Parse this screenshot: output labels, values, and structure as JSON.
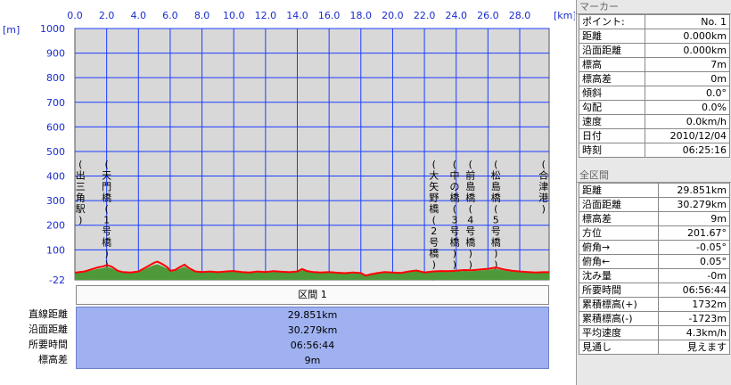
{
  "chart_data": {
    "type": "area",
    "x_unit": "[km]",
    "y_unit": "[m]",
    "xlim": [
      0,
      29.851
    ],
    "ylim": [
      -22,
      1000
    ],
    "x_ticks": [
      "0.0",
      "2.0",
      "4.0",
      "6.0",
      "8.0",
      "10.0",
      "12.0",
      "14.0",
      "16.0",
      "18.0",
      "20.0",
      "22.0",
      "24.0",
      "26.0",
      "28.0"
    ],
    "x_tick_values": [
      0,
      2,
      4,
      6,
      8,
      10,
      12,
      14,
      16,
      18,
      20,
      22,
      24,
      26,
      28
    ],
    "y_ticks": [
      "1000",
      "900",
      "800",
      "700",
      "600",
      "500",
      "400",
      "300",
      "200",
      "100",
      "-22"
    ],
    "y_tick_values": [
      1000,
      900,
      800,
      700,
      600,
      500,
      400,
      300,
      200,
      100,
      -22
    ],
    "grid": true,
    "series": [
      {
        "x": [
          0,
          0.3,
          0.6,
          1.0,
          1.4,
          1.8,
          2.0,
          2.3,
          2.7,
          3.0,
          3.5,
          4.0,
          4.5,
          5.0,
          5.2,
          5.5,
          5.8,
          6.0,
          6.3,
          6.6,
          6.9,
          7.2,
          7.6,
          8.0,
          8.5,
          9.0,
          9.5,
          10.0,
          10.5,
          11.0,
          11.5,
          12.0,
          12.5,
          13.0,
          13.5,
          14.0,
          14.3,
          14.6,
          15.0,
          15.5,
          16.0,
          16.5,
          17.0,
          17.5,
          18.0,
          18.3,
          18.6,
          19.0,
          19.5,
          20.0,
          20.5,
          21.0,
          21.5,
          22.0,
          22.5,
          23.0,
          23.5,
          24.0,
          24.5,
          25.0,
          25.5,
          26.0,
          26.5,
          27.0,
          27.5,
          28.0,
          28.5,
          29.0,
          29.5,
          29.851
        ],
        "y": [
          7,
          10,
          12,
          20,
          28,
          33,
          38,
          32,
          15,
          10,
          8,
          12,
          30,
          48,
          52,
          42,
          30,
          15,
          18,
          30,
          40,
          25,
          12,
          10,
          12,
          9,
          12,
          14,
          10,
          8,
          12,
          10,
          13,
          11,
          9,
          12,
          22,
          14,
          10,
          8,
          10,
          7,
          5,
          8,
          6,
          -5,
          0,
          5,
          10,
          8,
          6,
          12,
          16,
          8,
          12,
          14,
          13,
          15,
          18,
          17,
          20,
          23,
          28,
          20,
          15,
          12,
          10,
          8,
          9,
          9
        ]
      }
    ]
  },
  "landmarks": [
    {
      "label": "(出三角駅)",
      "x": 0.35
    },
    {
      "label": "(天門橋(1号橋))",
      "x": 2.0
    },
    {
      "label": "(大矢野橋(2号橋))",
      "x": 22.6
    },
    {
      "label": "(中の橋(3号橋))",
      "x": 23.9
    },
    {
      "label": "(前島橋(4号橋))",
      "x": 24.9
    },
    {
      "label": "(松島橋(5号橋))",
      "x": 26.5
    },
    {
      "label": "(合津港)",
      "x": 29.5
    }
  ],
  "section": {
    "title": "区間 1",
    "rows": [
      {
        "label": "直線距離",
        "value": "29.851km"
      },
      {
        "label": "沿面距離",
        "value": "30.279km"
      },
      {
        "label": "所要時間",
        "value": "06:56:44"
      },
      {
        "label": "標高差",
        "value": "9m"
      }
    ]
  },
  "marker_panel": {
    "title": "マーカー",
    "rows": [
      {
        "label": "ポイント:",
        "value": "No. 1"
      },
      {
        "label": "距離",
        "value": "0.000km"
      },
      {
        "label": "沿面距離",
        "value": "0.000km"
      },
      {
        "label": "標高",
        "value": "7m"
      },
      {
        "label": "標高差",
        "value": "0m"
      },
      {
        "label": "傾斜",
        "value": "0.0°"
      },
      {
        "label": "勾配",
        "value": "0.0%"
      },
      {
        "label": "速度",
        "value": "0.0km/h"
      },
      {
        "label": "日付",
        "value": "2010/12/04"
      },
      {
        "label": "時刻",
        "value": "06:25:16"
      }
    ]
  },
  "all_panel": {
    "title": "全区間",
    "rows": [
      {
        "label": "距離",
        "value": "29.851km"
      },
      {
        "label": "沿面距離",
        "value": "30.279km"
      },
      {
        "label": "標高差",
        "value": "9m"
      },
      {
        "label": "方位",
        "value": "201.67°"
      },
      {
        "label": "俯角→",
        "value": "-0.05°"
      },
      {
        "label": "俯角←",
        "value": "0.05°"
      },
      {
        "label": "沈み量",
        "value": "-0m"
      },
      {
        "label": "所要時間",
        "value": "06:56:44"
      },
      {
        "label": "累積標高(+)",
        "value": "1732m"
      },
      {
        "label": "累積標高(-)",
        "value": "-1723m"
      },
      {
        "label": "平均速度",
        "value": "4.3km/h"
      },
      {
        "label": "見通し",
        "value": "見えます"
      }
    ]
  },
  "colors": {
    "plot_bg": "#d8d8d8",
    "grid": "#1c3cff",
    "axis_text": "#1a2ccc",
    "terrain_fill": "#4e9a3a",
    "track_line": "#ff0000",
    "summary_bg": "#9fb1f0"
  }
}
